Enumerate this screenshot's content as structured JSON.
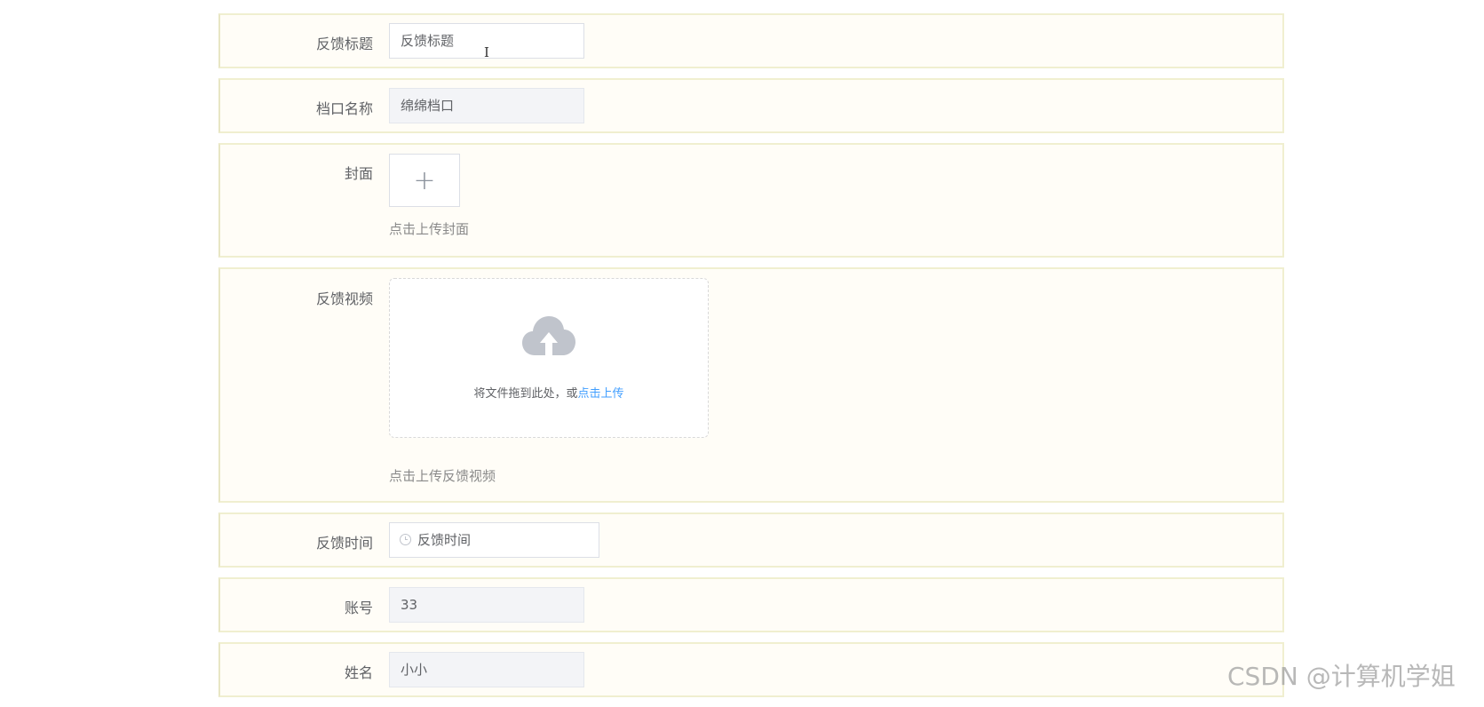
{
  "form": {
    "title_field": {
      "label": "反馈标题",
      "value": "反馈标题",
      "cursor_glyph": "I"
    },
    "stall_field": {
      "label": "档口名称",
      "value": "绵绵档口"
    },
    "cover_field": {
      "label": "封面",
      "upload_symbol": "+",
      "tip": "点击上传封面"
    },
    "video_field": {
      "label": "反馈视频",
      "drag_text": "将文件拖到此处，或",
      "drag_link": "点击上传",
      "tip": "点击上传反馈视频"
    },
    "time_field": {
      "label": "反馈时间",
      "placeholder": "反馈时间",
      "icon": "clock-icon"
    },
    "account_field": {
      "label": "账号",
      "value": "33"
    },
    "name_field": {
      "label": "姓名",
      "value": "小小"
    }
  },
  "watermark": "CSDN @计算机学姐",
  "colors": {
    "row_bg": "#fffdf7",
    "row_border": "#f0efd0",
    "link": "#409eff",
    "disabled_bg": "#f3f4f7"
  }
}
